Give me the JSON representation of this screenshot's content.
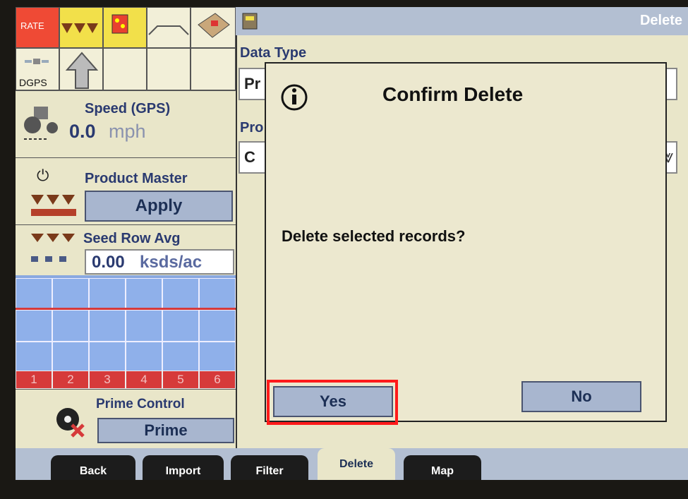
{
  "header": {
    "title": "Delete"
  },
  "left_panel": {
    "rate_label": "RATE",
    "dgps_label": "DGPS",
    "speed": {
      "title": "Speed (GPS)",
      "value": "0.0",
      "unit": "mph"
    },
    "product_master": {
      "title": "Product Master",
      "button": "Apply"
    },
    "seed_row": {
      "title": "Seed Row Avg",
      "value": "0.00",
      "unit": "ksds/ac"
    },
    "rows": [
      "1",
      "2",
      "3",
      "4",
      "5",
      "6"
    ],
    "prime": {
      "title": "Prime Control",
      "button": "Prime"
    }
  },
  "background_form": {
    "data_type_label": "Data Type",
    "field_partial_1": "Pr",
    "field_partial_2": "Pro",
    "field_partial_3": "C"
  },
  "dialog": {
    "title": "Confirm Delete",
    "message": "Delete selected records?",
    "yes": "Yes",
    "no": "No"
  },
  "tabs": [
    {
      "label": "Back",
      "active": false
    },
    {
      "label": "Import",
      "active": false
    },
    {
      "label": "Filter",
      "active": false
    },
    {
      "label": "Delete",
      "active": true
    },
    {
      "label": "Map",
      "active": false
    }
  ],
  "colors": {
    "accent": "#a8b6cf",
    "highlight": "#ff1a1a",
    "rate": "#e8412f",
    "row_red": "#d63a3a"
  }
}
